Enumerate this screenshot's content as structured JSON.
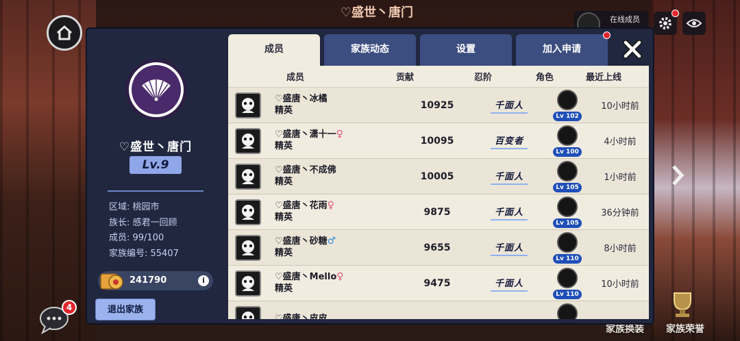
{
  "background": {
    "title": "♡盛世丶唐门"
  },
  "top_bar": {
    "online_label": "在线成员"
  },
  "chat": {
    "badge": "4"
  },
  "bottom": {
    "skin_label": "家族换装",
    "honor_label": "家族荣誉"
  },
  "clan": {
    "name": "♡盛世丶唐门",
    "level": "Lv.9",
    "info": [
      "区域: 桃园市",
      "族长: 感君一回顾",
      "成员: 99/100",
      "家族编号: 55407"
    ],
    "funds": "241790",
    "funds_info": "i",
    "quit_label": "退出家族"
  },
  "tabs": [
    {
      "label": "成员",
      "active": true
    },
    {
      "label": "家族动态",
      "active": false
    },
    {
      "label": "设置",
      "active": false
    },
    {
      "label": "加入申请",
      "active": false
    }
  ],
  "table": {
    "headers": [
      "成员",
      "贡献",
      "忍阶",
      "角色",
      "最近上线"
    ],
    "rows": [
      {
        "name": "♡盛唐丶冰橘",
        "gender": "",
        "title": "精英",
        "contribution": "10925",
        "rank": "千面人",
        "level": "Lv 102",
        "last_online": "10小时前"
      },
      {
        "name": "♡盛唐丶潇十一",
        "gender": "♀",
        "title": "精英",
        "contribution": "10095",
        "rank": "百变者",
        "level": "Lv 100",
        "last_online": "4小时前"
      },
      {
        "name": "♡盛唐丶不成佛",
        "gender": "",
        "title": "精英",
        "contribution": "10005",
        "rank": "千面人",
        "level": "Lv 105",
        "last_online": "1小时前"
      },
      {
        "name": "♡盛唐丶花雨",
        "gender": "♀",
        "title": "精英",
        "contribution": "9875",
        "rank": "千面人",
        "level": "Lv 105",
        "last_online": "36分钟前"
      },
      {
        "name": "♡盛唐丶砂糖",
        "gender": "♂",
        "title": "精英",
        "contribution": "9655",
        "rank": "千面人",
        "level": "Lv 110",
        "last_online": "8小时前"
      },
      {
        "name": "♡盛唐丶Mello",
        "gender": "♀",
        "title": "精英",
        "contribution": "9475",
        "rank": "千面人",
        "level": "Lv 110",
        "last_online": "10小时前"
      },
      {
        "name": "♡盛唐丶皮皮",
        "gender": "",
        "title": "",
        "contribution": "",
        "rank": "",
        "level": "",
        "last_online": ""
      }
    ]
  },
  "colors": {
    "panel": "#20273e",
    "tab_active": "#f1ece0",
    "tab_inactive": "#3c4d80",
    "level_badge": "#8fa6e8",
    "red_dot": "#e3262b"
  }
}
